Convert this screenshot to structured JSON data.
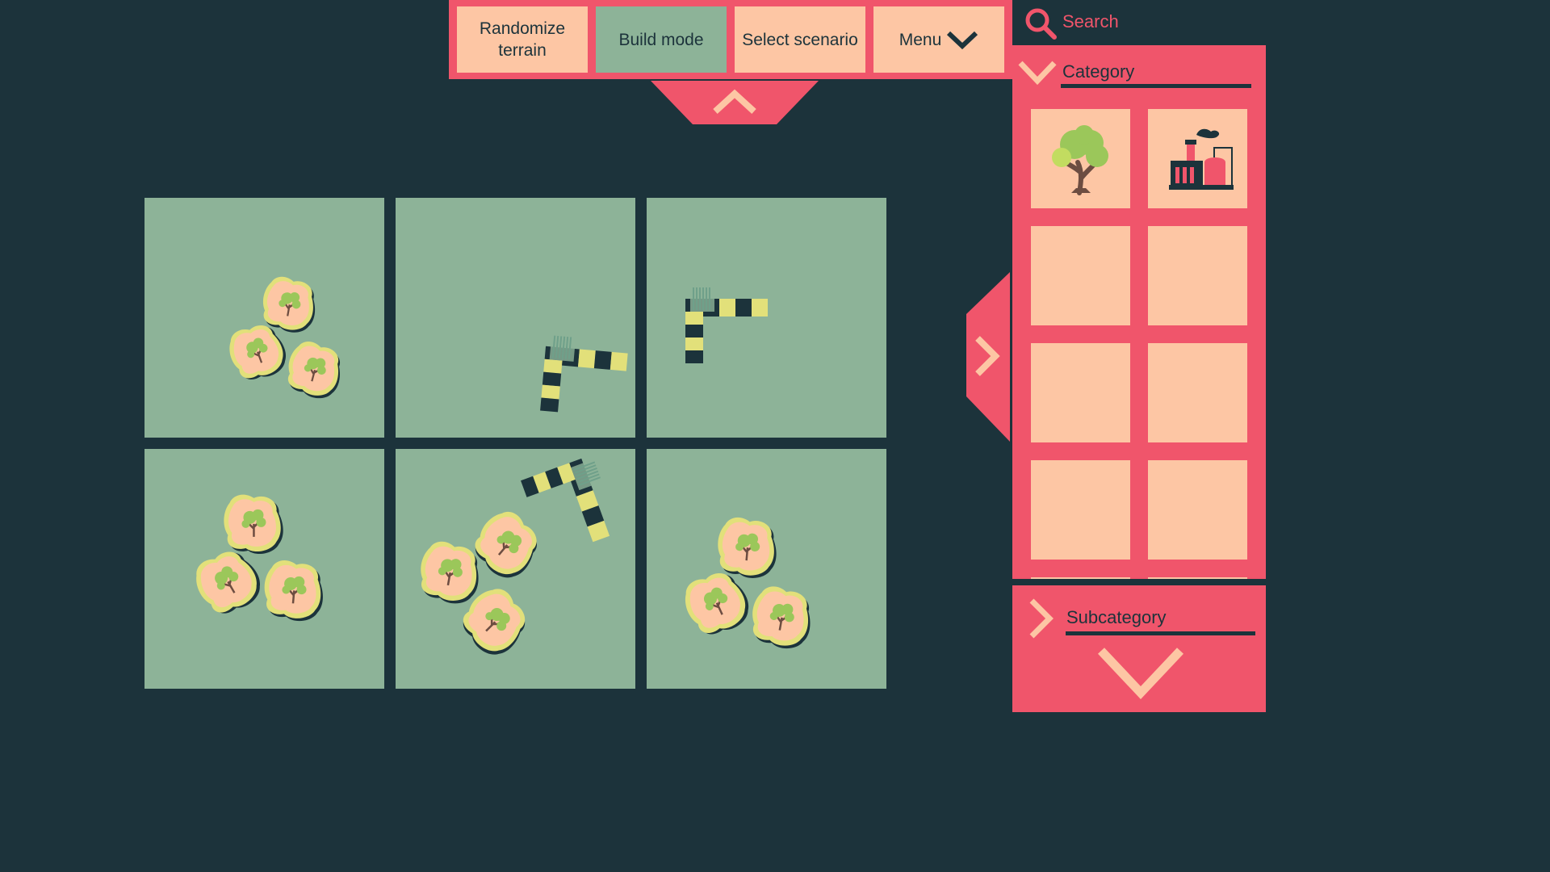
{
  "toolbar": {
    "randomize_label": "Randomize terrain",
    "build_mode_label": "Build mode",
    "select_scenario_label": "Select scenario",
    "menu_label": "Menu",
    "active_button": "build_mode"
  },
  "sidebar": {
    "search_placeholder": "Search",
    "category_label": "Category",
    "subcategory_label": "Subcategory",
    "items": [
      {
        "icon": "tree-icon"
      },
      {
        "icon": "factory-icon"
      },
      {
        "icon": ""
      },
      {
        "icon": ""
      },
      {
        "icon": ""
      },
      {
        "icon": ""
      },
      {
        "icon": ""
      },
      {
        "icon": ""
      }
    ]
  },
  "board": {
    "tiles": [
      {
        "content": "forest"
      },
      {
        "content": "building"
      },
      {
        "content": "building"
      },
      {
        "content": "forest"
      },
      {
        "content": "forest-and-building"
      },
      {
        "content": "forest"
      }
    ]
  },
  "colors": {
    "background": "#1c333b",
    "accent": "#f0556b",
    "panel": "#fdc6a4",
    "terrain": "#8db398",
    "highlight": "#e2e07a",
    "foliage": "#9bc75a"
  }
}
